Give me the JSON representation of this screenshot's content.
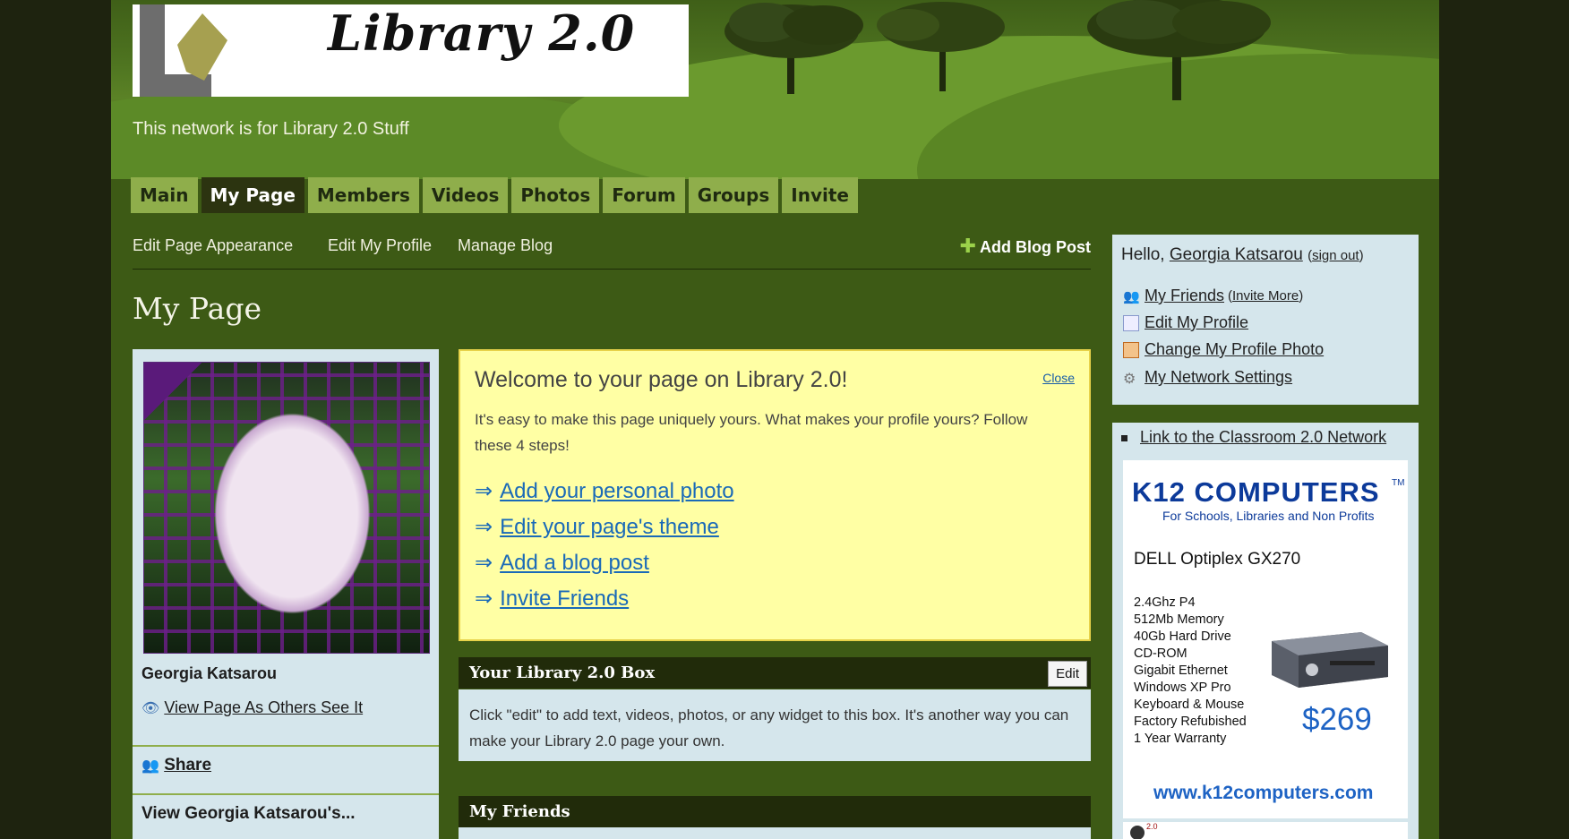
{
  "header": {
    "site_title": "Library 2.0",
    "tagline": "This network is for Library 2.0 Stuff"
  },
  "nav": {
    "tabs": [
      "Main",
      "My Page",
      "Members",
      "Videos",
      "Photos",
      "Forum",
      "Groups",
      "Invite"
    ],
    "active": "My Page"
  },
  "subnav": {
    "edit_appearance": "Edit Page Appearance",
    "edit_profile": "Edit My Profile",
    "manage_blog": "Manage Blog",
    "add_blog_post": "Add Blog Post"
  },
  "page_title": "My Page",
  "profile": {
    "name": "Georgia Katsarou",
    "view_as_others": "View Page As Others See It",
    "share": "Share",
    "view_more": "View Georgia Katsarou's..."
  },
  "welcome": {
    "title": "Welcome to your page on Library 2.0!",
    "close": "Close",
    "text": "It's easy to make this page uniquely yours. What makes your profile yours? Follow these 4 steps!",
    "arrow": "⇒",
    "steps": [
      "Add your personal photo",
      "Edit your page's theme",
      "Add a blog post",
      "Invite Friends"
    ]
  },
  "library_box": {
    "title": "Your Library 2.0 Box",
    "edit": "Edit",
    "body": "Click \"edit\" to add text, videos, photos, or any widget to this box. It's another way you can make your Library 2.0 page your own."
  },
  "friends_box": {
    "title": "My Friends"
  },
  "userbox": {
    "hello": "Hello,",
    "user": "Georgia Katsarou",
    "sign_out_open": "(",
    "sign_out": "sign out",
    "sign_out_close": ")",
    "links": {
      "my_friends": "My Friends",
      "invite_more": "Invite More",
      "edit_profile": "Edit My Profile",
      "change_photo": "Change My Profile Photo",
      "network_settings": "My Network Settings"
    }
  },
  "sidebar": {
    "classroom_link": "Link to the Classroom 2.0 Network",
    "ad": {
      "brand": "K12 COMPUTERS",
      "tm": "TM",
      "tagline": "For Schools, Libraries and Non Profits",
      "model": "DELL Optiplex GX270",
      "specs": [
        "2.4Ghz P4",
        "512Mb Memory",
        "40Gb Hard Drive",
        "CD-ROM",
        "Gigabit Ethernet",
        "Windows XP Pro",
        "Keyboard & Mouse",
        "Factory Refubished",
        "1 Year Warranty"
      ],
      "price": "$269",
      "url": "www.k12computers.com"
    },
    "widget_label": "2.0"
  },
  "colors": {
    "page_bg": "#3d5a15",
    "nav_tab": "#8fae4b",
    "nav_active": "#2c3410",
    "panel": "#d5e6ec",
    "welcome_bg": "#ffffa4",
    "link_blue": "#1a6ab8"
  }
}
